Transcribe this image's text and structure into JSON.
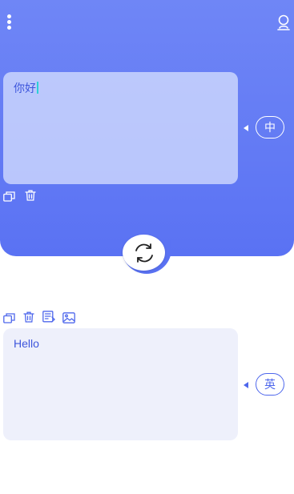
{
  "source": {
    "text": "你好",
    "language": "中"
  },
  "target": {
    "text": "Hello",
    "language": "英"
  },
  "icons": {
    "menu": "more-vertical-icon",
    "profile": "user-icon",
    "copy": "copy-icon",
    "delete": "trash-icon",
    "edit": "edit-note-icon",
    "image": "image-icon",
    "swap": "swap-refresh-icon"
  },
  "colors": {
    "accent": "#5a72f3",
    "text_accent": "#3e56dc",
    "cursor": "#2ad0d6"
  }
}
